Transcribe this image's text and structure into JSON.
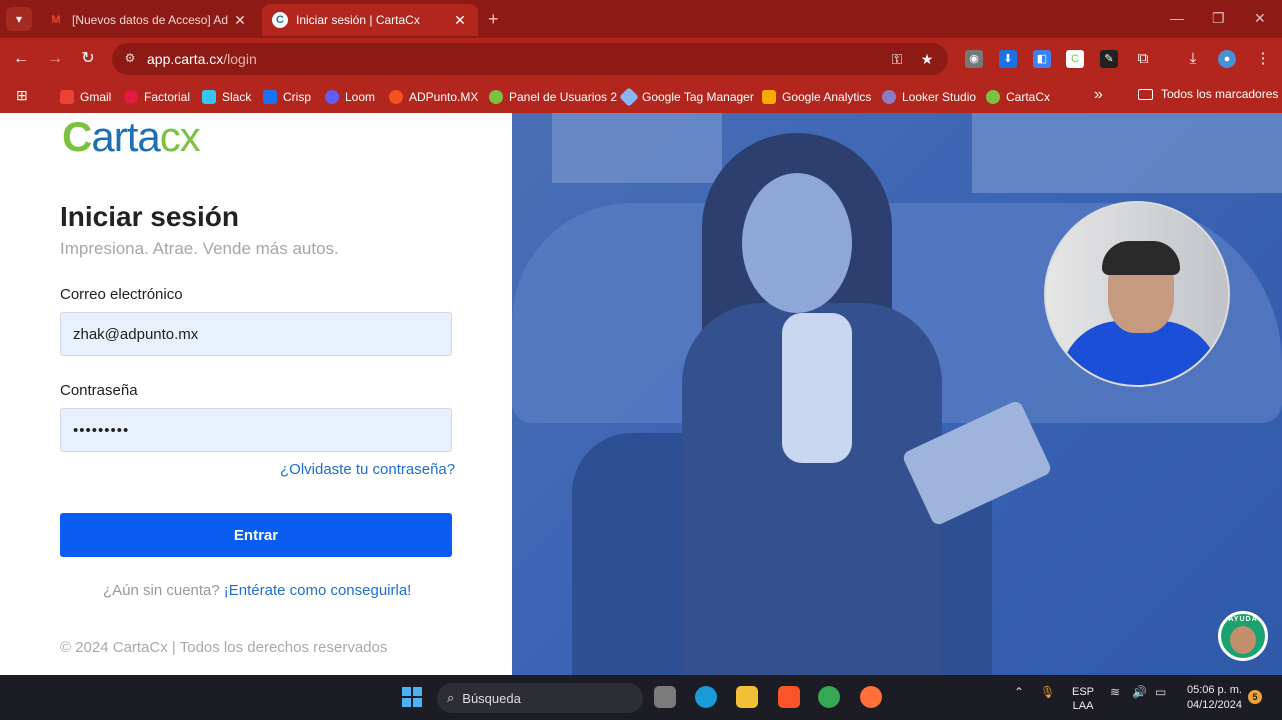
{
  "browser": {
    "tabs": [
      {
        "title": "[Nuevos datos de Acceso] Ad P",
        "active": false,
        "favicon": "gmail-icon"
      },
      {
        "title": "Iniciar sesión | CartaCx",
        "active": true,
        "favicon": "cartacx-icon"
      }
    ],
    "url_host": "app.carta.cx",
    "url_path": "/login",
    "bookmarks": [
      {
        "label": "Gmail",
        "color": "#ea4335"
      },
      {
        "label": "Factorial",
        "color": "#e51943"
      },
      {
        "label": "Slack",
        "color": "#4a154b"
      },
      {
        "label": "Crisp",
        "color": "#1972f5"
      },
      {
        "label": "Loom",
        "color": "#625df5"
      },
      {
        "label": "ADPunto.MX",
        "color": "#f4511e"
      },
      {
        "label": "Panel de Usuarios 2",
        "color": "#7cc242"
      },
      {
        "label": "Google Tag Manager",
        "color": "#8ab4f8"
      },
      {
        "label": "Google Analytics",
        "color": "#f9ab00"
      },
      {
        "label": "Looker Studio",
        "color": "#8e7cc3"
      },
      {
        "label": "CartaCx",
        "color": "#7cc242"
      }
    ],
    "all_bookmarks": "Todos los marcadores"
  },
  "login": {
    "logo_first": "C",
    "logo_mid": "arta",
    "logo_last": "cx",
    "title": "Iniciar sesión",
    "subtitle": "Impresiona. Atrae. Vende más autos.",
    "email_label": "Correo electrónico",
    "email_value": "zhak@adpunto.mx",
    "password_label": "Contraseña",
    "password_value": "•••••••••",
    "forgot": "¿Olvidaste tu contraseña?",
    "submit": "Entrar",
    "no_account": "¿Aún sin cuenta?",
    "signup_link": "¡Entérate como conseguirla!",
    "copyright": "© 2024 CartaCx | Todos los derechos reservados",
    "help_badge": "AYUDA"
  },
  "taskbar": {
    "search": "Búsqueda",
    "lang_line1": "ESP",
    "lang_line2": "LAA",
    "time": "05:06 p. m.",
    "date": "04/12/2024",
    "notifications": "5"
  }
}
